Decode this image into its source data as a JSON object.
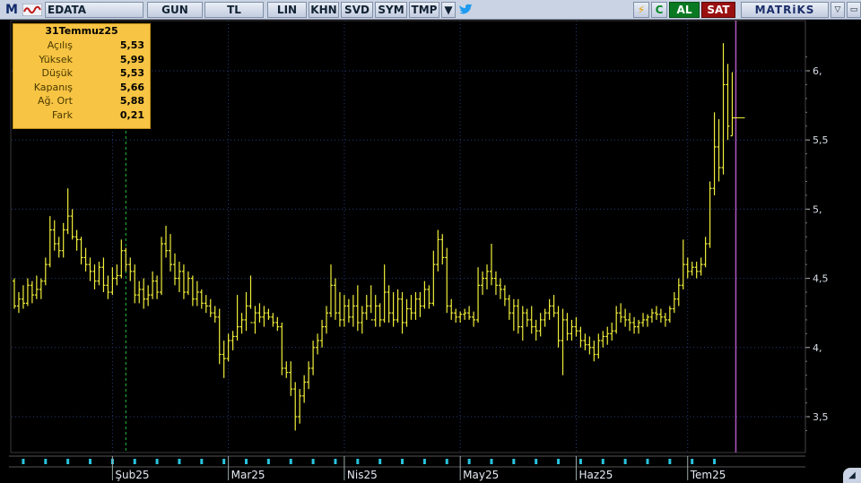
{
  "toolbar": {
    "m_label": "M",
    "logo_icon": "matriks-wave-icon",
    "symbol": "EDATA",
    "period": "GUN",
    "currency": "TL",
    "lin": "LIN",
    "khn": "KHN",
    "svd": "SVD",
    "sym": "SYM",
    "tmp": "TMP",
    "caret": "▼",
    "twitter_icon": "twitter-bird-icon",
    "bolt": "⚡",
    "c": "C",
    "buy": "AL",
    "sell": "SAT",
    "brand": "MATRiKS",
    "mini1": "▽",
    "mini2": "▭"
  },
  "info": {
    "date": "31Temmuz25",
    "rows": [
      {
        "label": "Açılış",
        "value": "5,53"
      },
      {
        "label": "Yüksek",
        "value": "5,99"
      },
      {
        "label": "Düşük",
        "value": "5,53"
      },
      {
        "label": "Kapanış",
        "value": "5,66"
      },
      {
        "label": "Ağ. Ort",
        "value": "5,88"
      },
      {
        "label": "Fark",
        "value": "0,21"
      }
    ]
  },
  "colors": {
    "background": "#000000",
    "bars": "#f0ee3a",
    "grid": "#2a3a7a",
    "cursor": "#23c23a",
    "last_marker": "#b055c0",
    "tick_marks": "#29c4de",
    "info_bg": "#f7c443"
  },
  "chart_data": {
    "type": "ohlc",
    "y_ticks": [
      {
        "value": 6.0,
        "label": "6,"
      },
      {
        "value": 5.5,
        "label": "5,5"
      },
      {
        "value": 5.0,
        "label": "5,"
      },
      {
        "value": 4.5,
        "label": "4,5"
      },
      {
        "value": 4.0,
        "label": "4,"
      },
      {
        "value": 3.5,
        "label": "3,5"
      }
    ],
    "ylim": [
      3.25,
      6.2
    ],
    "x_labels": [
      "Şub25",
      "Mar25",
      "Nis25",
      "May25",
      "Haz25",
      "Tem25"
    ],
    "x_label_index": [
      22,
      48,
      74,
      100,
      126,
      151
    ],
    "cursor_index": 25,
    "bar_count": 178,
    "bars": [
      [
        4.48,
        4.5,
        4.28,
        4.3
      ],
      [
        4.3,
        4.4,
        4.25,
        4.35
      ],
      [
        4.35,
        4.45,
        4.28,
        4.32
      ],
      [
        4.32,
        4.5,
        4.3,
        4.45
      ],
      [
        4.45,
        4.48,
        4.32,
        4.38
      ],
      [
        4.38,
        4.52,
        4.35,
        4.42
      ],
      [
        4.42,
        4.5,
        4.35,
        4.48
      ],
      [
        4.48,
        4.65,
        4.45,
        4.6
      ],
      [
        4.6,
        4.95,
        4.58,
        4.85
      ],
      [
        4.85,
        4.92,
        4.7,
        4.75
      ],
      [
        4.75,
        4.8,
        4.65,
        4.7
      ],
      [
        4.7,
        4.9,
        4.65,
        4.85
      ],
      [
        4.85,
        5.15,
        4.82,
        4.95
      ],
      [
        4.95,
        5.0,
        4.78,
        4.8
      ],
      [
        4.8,
        4.85,
        4.7,
        4.78
      ],
      [
        4.78,
        4.8,
        4.6,
        4.65
      ],
      [
        4.65,
        4.72,
        4.55,
        4.6
      ],
      [
        4.6,
        4.65,
        4.48,
        4.55
      ],
      [
        4.55,
        4.6,
        4.42,
        4.48
      ],
      [
        4.48,
        4.62,
        4.45,
        4.58
      ],
      [
        4.58,
        4.65,
        4.4,
        4.45
      ],
      [
        4.45,
        4.52,
        4.35,
        4.4
      ],
      [
        4.4,
        4.58,
        4.38,
        4.5
      ],
      [
        4.5,
        4.6,
        4.45,
        4.52
      ],
      [
        4.52,
        4.78,
        4.5,
        4.7
      ],
      [
        4.7,
        4.72,
        4.55,
        4.6
      ],
      [
        4.6,
        4.65,
        4.48,
        4.55
      ],
      [
        4.55,
        4.6,
        4.32,
        4.38
      ],
      [
        4.38,
        4.48,
        4.32,
        4.42
      ],
      [
        4.42,
        4.5,
        4.28,
        4.35
      ],
      [
        4.35,
        4.45,
        4.3,
        4.38
      ],
      [
        4.38,
        4.55,
        4.35,
        4.48
      ],
      [
        4.48,
        4.52,
        4.35,
        4.4
      ],
      [
        4.4,
        4.8,
        4.38,
        4.75
      ],
      [
        4.75,
        4.88,
        4.65,
        4.7
      ],
      [
        4.7,
        4.82,
        4.55,
        4.6
      ],
      [
        4.6,
        4.68,
        4.45,
        4.5
      ],
      [
        4.5,
        4.62,
        4.4,
        4.55
      ],
      [
        4.55,
        4.6,
        4.35,
        4.4
      ],
      [
        4.4,
        4.55,
        4.38,
        4.5
      ],
      [
        4.5,
        4.52,
        4.3,
        4.35
      ],
      [
        4.35,
        4.48,
        4.3,
        4.4
      ],
      [
        4.4,
        4.42,
        4.28,
        4.32
      ],
      [
        4.32,
        4.38,
        4.25,
        4.3
      ],
      [
        4.3,
        4.35,
        4.22,
        4.25
      ],
      [
        4.25,
        4.3,
        4.18,
        4.22
      ],
      [
        4.22,
        4.28,
        3.88,
        3.95
      ],
      [
        3.95,
        4.05,
        3.78,
        3.92
      ],
      [
        3.92,
        4.1,
        3.9,
        4.05
      ],
      [
        4.05,
        4.12,
        3.98,
        4.08
      ],
      [
        4.08,
        4.38,
        4.05,
        4.15
      ],
      [
        4.15,
        4.25,
        4.1,
        4.2
      ],
      [
        4.2,
        4.4,
        4.12,
        4.3
      ],
      [
        4.3,
        4.52,
        4.28,
        4.18
      ],
      [
        4.18,
        4.3,
        4.1,
        4.25
      ],
      [
        4.25,
        4.32,
        4.18,
        4.22
      ],
      [
        4.22,
        4.3,
        4.15,
        4.25
      ],
      [
        4.25,
        4.28,
        4.2,
        4.22
      ],
      [
        4.22,
        4.25,
        4.15,
        4.18
      ],
      [
        4.18,
        4.22,
        4.12,
        4.15
      ],
      [
        4.15,
        4.18,
        3.8,
        3.85
      ],
      [
        3.85,
        3.9,
        3.78,
        3.82
      ],
      [
        3.82,
        3.9,
        3.65,
        3.7
      ],
      [
        3.7,
        3.75,
        3.4,
        3.5
      ],
      [
        3.5,
        3.7,
        3.45,
        3.65
      ],
      [
        3.65,
        3.8,
        3.6,
        3.75
      ],
      [
        3.75,
        3.9,
        3.7,
        3.85
      ],
      [
        3.85,
        4.05,
        3.8,
        4.0
      ],
      [
        4.0,
        4.1,
        3.95,
        4.05
      ],
      [
        4.05,
        4.2,
        4.0,
        4.15
      ],
      [
        4.15,
        4.3,
        4.1,
        4.25
      ],
      [
        4.25,
        4.6,
        4.22,
        4.45
      ],
      [
        4.45,
        4.5,
        4.2,
        4.25
      ],
      [
        4.25,
        4.4,
        4.15,
        4.2
      ],
      [
        4.2,
        4.38,
        4.15,
        4.3
      ],
      [
        4.3,
        4.35,
        4.18,
        4.22
      ],
      [
        4.22,
        4.38,
        4.15,
        4.3
      ],
      [
        4.3,
        4.45,
        4.12,
        4.18
      ],
      [
        4.18,
        4.3,
        4.1,
        4.25
      ],
      [
        4.25,
        4.38,
        4.2,
        4.3
      ],
      [
        4.3,
        4.45,
        4.25,
        4.2
      ],
      [
        4.2,
        4.38,
        4.15,
        4.3
      ],
      [
        4.3,
        4.32,
        4.15,
        4.2
      ],
      [
        4.2,
        4.6,
        4.18,
        4.4
      ],
      [
        4.4,
        4.45,
        4.18,
        4.25
      ],
      [
        4.25,
        4.4,
        4.15,
        4.2
      ],
      [
        4.2,
        4.42,
        4.18,
        4.35
      ],
      [
        4.35,
        4.4,
        4.1,
        4.18
      ],
      [
        4.18,
        4.35,
        4.15,
        4.28
      ],
      [
        4.28,
        4.38,
        4.2,
        4.25
      ],
      [
        4.25,
        4.4,
        4.2,
        4.35
      ],
      [
        4.35,
        4.4,
        4.22,
        4.3
      ],
      [
        4.3,
        4.48,
        4.28,
        4.42
      ],
      [
        4.42,
        4.45,
        4.28,
        4.32
      ],
      [
        4.32,
        4.7,
        4.3,
        4.6
      ],
      [
        4.6,
        4.85,
        4.55,
        4.78
      ],
      [
        4.78,
        4.82,
        4.6,
        4.65
      ],
      [
        4.65,
        4.72,
        4.25,
        4.3
      ],
      [
        4.3,
        4.35,
        4.2,
        4.25
      ],
      [
        4.25,
        4.28,
        4.18,
        4.22
      ],
      [
        4.22,
        4.26,
        4.18,
        4.24
      ],
      [
        4.24,
        4.28,
        4.2,
        4.25
      ],
      [
        4.25,
        4.3,
        4.2,
        4.22
      ],
      [
        4.22,
        4.26,
        4.15,
        4.2
      ],
      [
        4.2,
        4.58,
        4.18,
        4.45
      ],
      [
        4.45,
        4.55,
        4.38,
        4.5
      ],
      [
        4.5,
        4.6,
        4.42,
        4.55
      ],
      [
        4.55,
        4.75,
        4.45,
        4.5
      ],
      [
        4.5,
        4.55,
        4.38,
        4.45
      ],
      [
        4.45,
        4.5,
        4.35,
        4.42
      ],
      [
        4.42,
        4.45,
        4.3,
        4.35
      ],
      [
        4.35,
        4.38,
        4.2,
        4.25
      ],
      [
        4.25,
        4.35,
        4.12,
        4.3
      ],
      [
        4.3,
        4.35,
        4.1,
        4.15
      ],
      [
        4.15,
        4.3,
        4.05,
        4.25
      ],
      [
        4.25,
        4.28,
        4.15,
        4.2
      ],
      [
        4.2,
        4.3,
        4.1,
        4.15
      ],
      [
        4.15,
        4.2,
        4.05,
        4.12
      ],
      [
        4.12,
        4.25,
        4.08,
        4.2
      ],
      [
        4.2,
        4.28,
        4.15,
        4.25
      ],
      [
        4.25,
        4.35,
        4.2,
        4.3
      ],
      [
        4.3,
        4.38,
        4.22,
        4.25
      ],
      [
        4.25,
        4.3,
        4.0,
        4.05
      ],
      [
        4.05,
        4.28,
        3.8,
        4.2
      ],
      [
        4.2,
        4.25,
        4.05,
        4.1
      ],
      [
        4.1,
        4.2,
        4.05,
        4.15
      ],
      [
        4.15,
        4.22,
        4.08,
        4.12
      ],
      [
        4.12,
        4.15,
        4.0,
        4.05
      ],
      [
        4.05,
        4.1,
        3.98,
        4.02
      ],
      [
        4.02,
        4.08,
        3.95,
        4.0
      ],
      [
        4.0,
        4.05,
        3.9,
        3.95
      ],
      [
        3.95,
        4.1,
        3.92,
        4.05
      ],
      [
        4.05,
        4.12,
        4.0,
        4.08
      ],
      [
        4.08,
        4.15,
        4.02,
        4.1
      ],
      [
        4.1,
        4.18,
        4.05,
        4.12
      ],
      [
        4.12,
        4.3,
        4.1,
        4.25
      ],
      [
        4.25,
        4.32,
        4.18,
        4.22
      ],
      [
        4.22,
        4.28,
        4.15,
        4.2
      ],
      [
        4.2,
        4.25,
        4.12,
        4.18
      ],
      [
        4.18,
        4.22,
        4.1,
        4.15
      ],
      [
        4.15,
        4.2,
        4.1,
        4.18
      ],
      [
        4.18,
        4.25,
        4.15,
        4.2
      ],
      [
        4.2,
        4.24,
        4.15,
        4.22
      ],
      [
        4.22,
        4.28,
        4.18,
        4.25
      ],
      [
        4.25,
        4.3,
        4.2,
        4.24
      ],
      [
        4.24,
        4.28,
        4.18,
        4.22
      ],
      [
        4.22,
        4.25,
        4.15,
        4.2
      ],
      [
        4.2,
        4.3,
        4.18,
        4.28
      ],
      [
        4.28,
        4.4,
        4.25,
        4.35
      ],
      [
        4.35,
        4.5,
        4.3,
        4.45
      ],
      [
        4.45,
        4.78,
        4.42,
        4.6
      ],
      [
        4.6,
        4.65,
        4.5,
        4.55
      ],
      [
        4.55,
        4.62,
        4.52,
        4.58
      ],
      [
        4.58,
        4.62,
        4.5,
        4.55
      ],
      [
        4.55,
        4.65,
        4.52,
        4.6
      ],
      [
        4.6,
        4.8,
        4.58,
        4.75
      ],
      [
        4.75,
        5.2,
        4.72,
        5.15
      ],
      [
        5.15,
        5.7,
        5.1,
        5.45
      ],
      [
        5.45,
        5.65,
        5.2,
        5.3
      ],
      [
        5.3,
        6.2,
        5.25,
        5.9
      ],
      [
        5.9,
        6.05,
        5.5,
        5.6
      ],
      [
        5.53,
        5.99,
        5.53,
        5.66
      ]
    ]
  }
}
